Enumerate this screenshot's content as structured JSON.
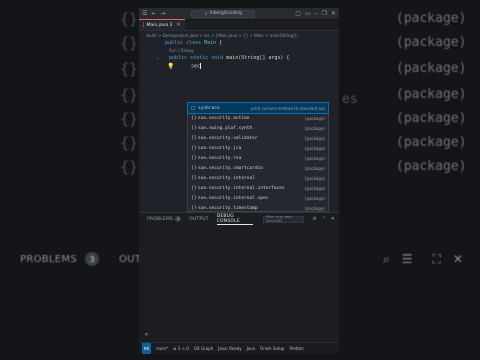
{
  "background": {
    "braces": [
      "{}",
      "{}",
      "{}",
      "{}",
      "{}",
      "{}",
      "{}"
    ],
    "packages": [
      "(package)",
      "(package)",
      "(package)",
      "(package)",
      "(package)",
      "(package)",
      "(package)"
    ],
    "partial_text": "es",
    "panel_title": "PROBLEMS",
    "panel_badge": "3",
    "panel_output": "OUTPUT"
  },
  "window": {
    "search": "mbmgitcoding",
    "tab_label": "Main.java 3",
    "breadcrumb": "skufo > Demoproject.java > src > J Main.java > {} > Main > main(String[])"
  },
  "editor": {
    "line1": {
      "kw": "public",
      "kw2": "class",
      "cls": "Main",
      "rest": " {"
    },
    "codelens": "Run | Debug",
    "line2": {
      "kw": "public",
      "kw2": "static",
      "kw3": "void",
      "fn": "main",
      "params": "(String[] args) {"
    },
    "typed": "sec"
  },
  "suggestions": [
    {
      "icon": "□",
      "label": "sysbrace",
      "detail": "print current method to standard out"
    },
    {
      "icon": "{}",
      "label": "sun.security.action",
      "detail": "(package)"
    },
    {
      "icon": "{}",
      "label": "sun.swing.plaf.synth",
      "detail": "(package)"
    },
    {
      "icon": "{}",
      "label": "sun.security.validator",
      "detail": "(package)"
    },
    {
      "icon": "{}",
      "label": "sun.security.jca",
      "detail": "(package)"
    },
    {
      "icon": "{}",
      "label": "sun.security.rsa",
      "detail": "(package)"
    },
    {
      "icon": "{}",
      "label": "sun.security.smartcardio",
      "detail": "(package)"
    },
    {
      "icon": "{}",
      "label": "sun.security.internal",
      "detail": "(package)"
    },
    {
      "icon": "{}",
      "label": "sun.security.internal.interfaces",
      "detail": "(package)"
    },
    {
      "icon": "{}",
      "label": "sun.security.internal.spec",
      "detail": "(package)"
    },
    {
      "icon": "{}",
      "label": "sun.security.timestamp",
      "detail": "(package)"
    },
    {
      "icon": "{}",
      "label": "sun.security.util.math",
      "detail": "(package)"
    }
  ],
  "panel": {
    "tabs": [
      "PROBLEMS",
      "OUTPUT",
      "DEBUG CONSOLE"
    ],
    "problems_badge": "3",
    "filter_placeholder": "Filter (e.g. text, !exclude)",
    "prompt": ">"
  },
  "statusbar": {
    "branch": "main*",
    "errors": "⊗ 3 ⚠ 0",
    "items": [
      "Git Graph",
      "Java: Ready",
      "Java",
      "Finish Setup",
      "Prettier"
    ]
  },
  "colors": {
    "accent": "#0e639c",
    "tab_border": "#e0684b",
    "selection": "#04395e"
  }
}
